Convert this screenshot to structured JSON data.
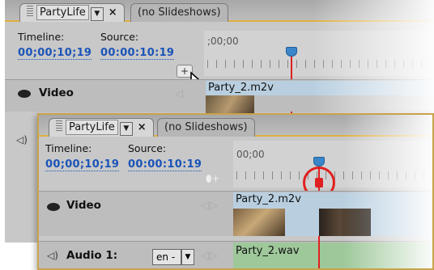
{
  "back_panel": {
    "tabs": [
      {
        "label": "PartyLife",
        "menu": "▼",
        "close": "×"
      },
      {
        "label": "(no Slideshows)"
      }
    ],
    "timeline_label": "Timeline:",
    "timeline_value": "00;00;10;19",
    "source_label": "Source:",
    "source_value": "00:00:10:19",
    "ruler_start": ";00;00",
    "video_track": {
      "name": "Video",
      "clip": "Party_2.m2v"
    }
  },
  "front_panel": {
    "tabs": [
      {
        "label": "PartyLife",
        "menu": "▼",
        "close": "×"
      },
      {
        "label": "(no Slideshows)"
      }
    ],
    "timeline_label": "Timeline:",
    "timeline_value": "00;00;10;19",
    "source_label": "Source:",
    "source_value": "00:00:10:19",
    "ruler_start": "00;00",
    "video_track": {
      "name": "Video",
      "clip": "Party_2.m2v"
    },
    "audio_track": {
      "name": "Audio 1:",
      "language": "en",
      "clip": "Party_2.wav"
    }
  },
  "icons": [
    "eye-icon",
    "speaker-icon",
    "mouse-pointer-icon",
    "add-marker-icon",
    "playhead-icon",
    "keyframe-nav-icon"
  ],
  "colors": {
    "accent_border": "#e0b040",
    "timecode_blue": "#1a54b8",
    "playhead": "#3a86c8",
    "playhead_line": "#e02020",
    "video_clip": "#b9cfe0",
    "audio_clip": "#9ec89a"
  }
}
